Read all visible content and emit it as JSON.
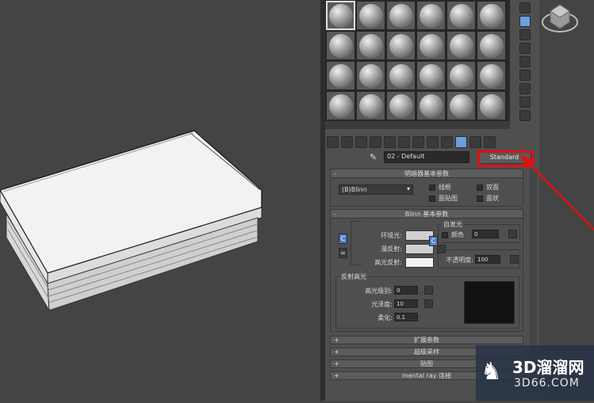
{
  "material_slots": [
    1,
    2,
    3,
    4,
    5,
    6,
    7,
    8,
    9,
    10,
    11,
    12,
    13,
    14,
    15,
    16,
    17,
    18,
    19,
    20,
    21,
    22,
    23,
    24
  ],
  "material_name": "02 - Default",
  "material_type_button": "Standard",
  "shader_basic": {
    "title": "明暗器基本参数",
    "shader": "(B)Blinn",
    "wire": "线框",
    "two_sided": "双面",
    "face_map": "面贴图",
    "faceted": "面状"
  },
  "blinn_basic": {
    "title": "Blinn 基本参数",
    "ambient": "环境光:",
    "diffuse": "漫反射:",
    "specular": "高光反射:",
    "self_illum": "自发光",
    "color": "颜色",
    "color_value": "0",
    "opacity": "不透明度:",
    "opacity_value": "100",
    "lock_left_top": "C",
    "lock_left_bottom": "=",
    "lock_right": "C"
  },
  "specular_highlights": {
    "title": "反射高光",
    "level_label": "高光级别:",
    "level_value": "0",
    "gloss_label": "光泽度:",
    "gloss_value": "10",
    "soften_label": "柔化:",
    "soften_value": "0.1"
  },
  "collapsed_rollouts": [
    {
      "sign": "+",
      "label": "扩展参数"
    },
    {
      "sign": "+",
      "label": "超级采样"
    },
    {
      "sign": "+",
      "label": "贴图"
    },
    {
      "sign": "+",
      "label": "mental ray 连接"
    }
  ],
  "rollout_sign_minus": "-",
  "watermark": {
    "title": "3D溜溜网",
    "url": "3D66.COM"
  },
  "colors": {
    "highlight_box": "#e01010",
    "selected_button": "#6aa0e0"
  }
}
